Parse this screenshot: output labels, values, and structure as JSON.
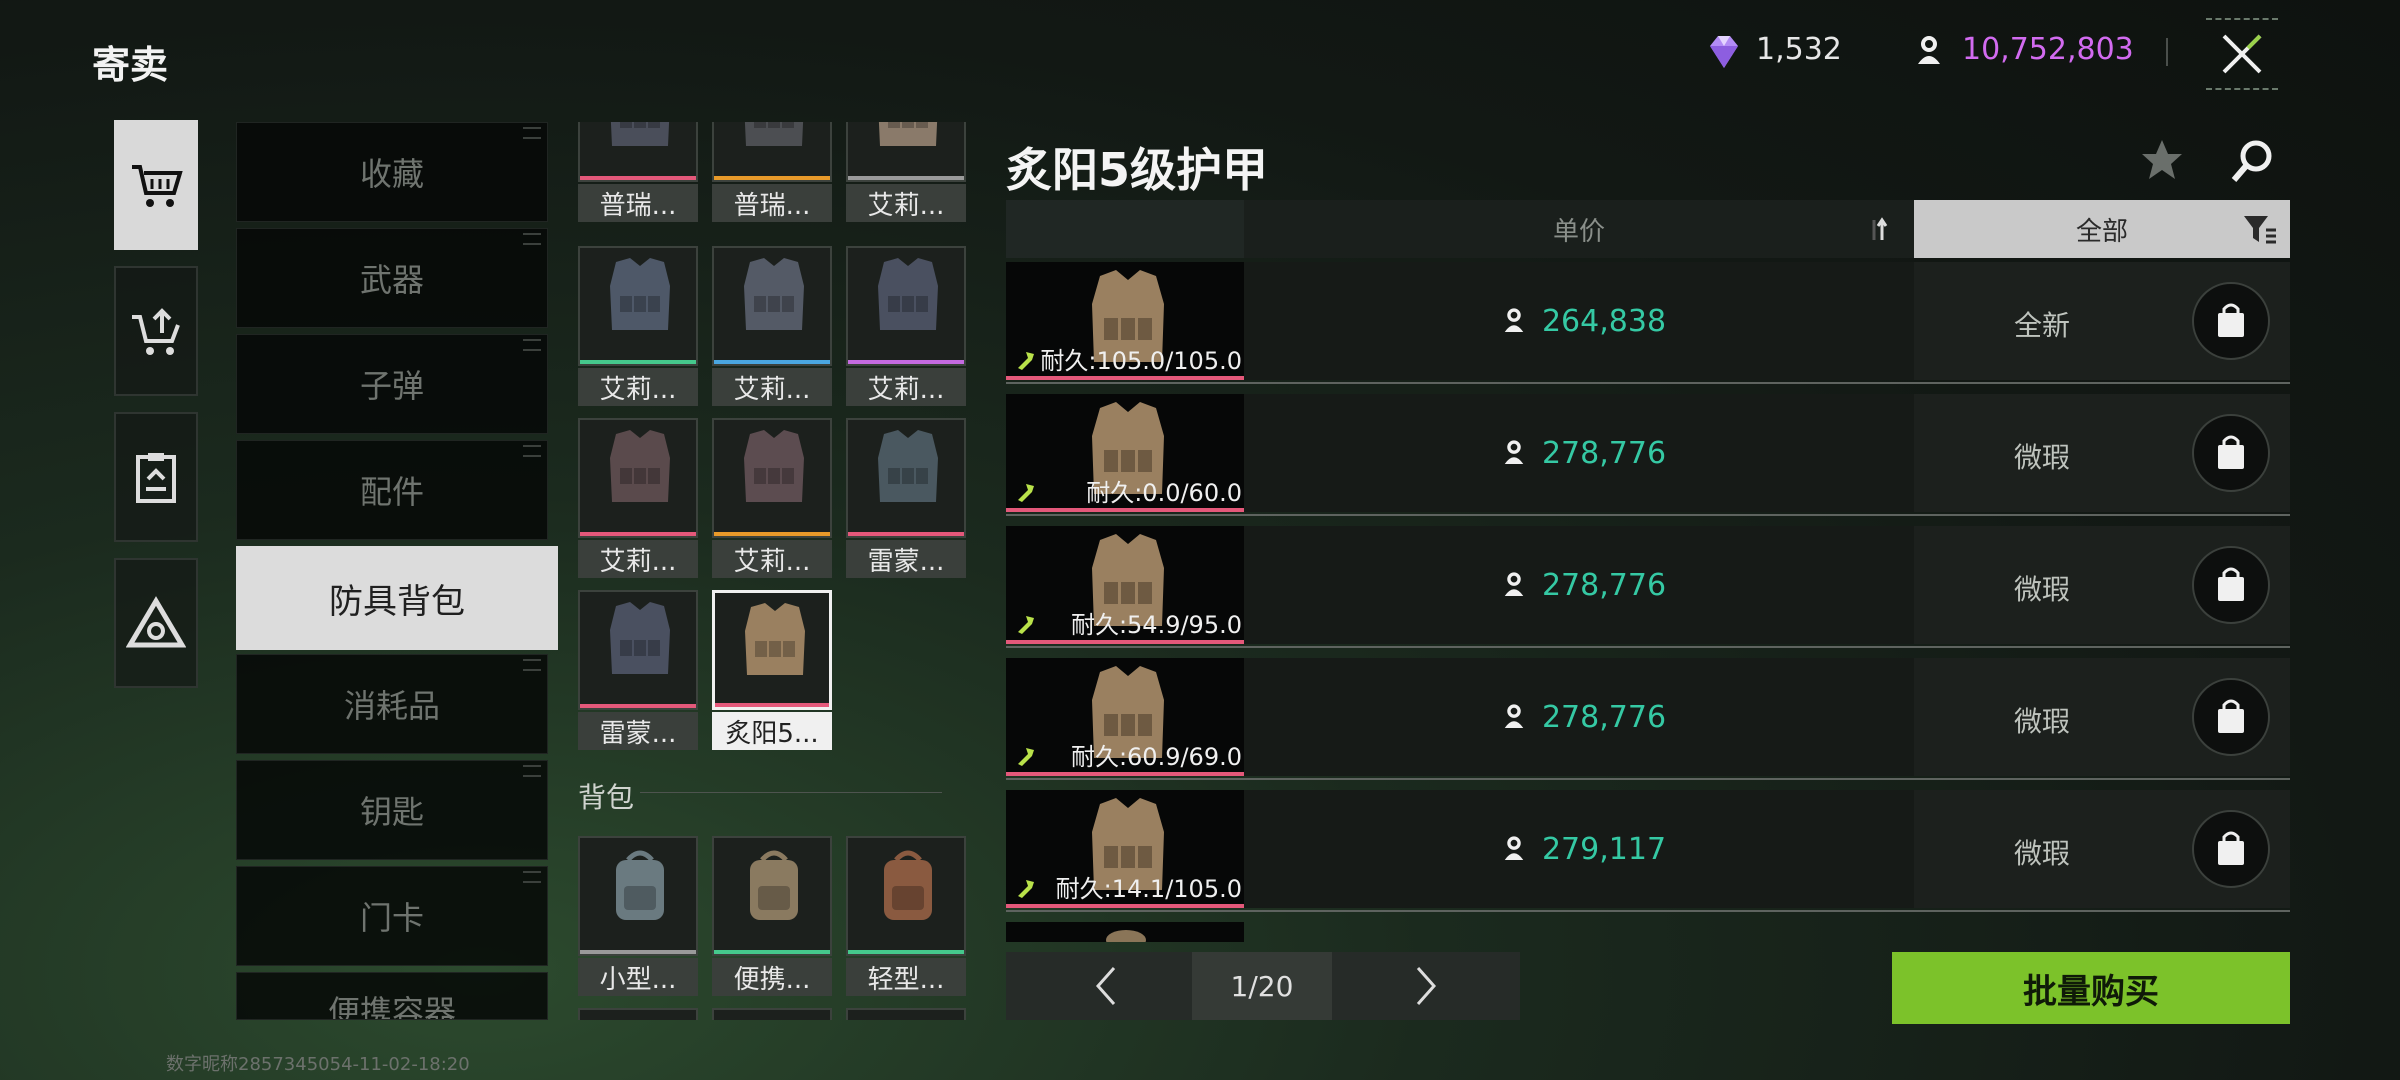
{
  "header": {
    "title": "寄卖",
    "diamonds": "1,532",
    "coins": "10,752,803",
    "close_icon": "close-icon"
  },
  "side_nav": [
    {
      "icon": "cart-icon",
      "active": true
    },
    {
      "icon": "cart-upload-icon",
      "active": false
    },
    {
      "icon": "clipboard-icon",
      "active": false
    },
    {
      "icon": "triangle-logo-icon",
      "active": false
    }
  ],
  "categories": [
    {
      "label": "收藏"
    },
    {
      "label": "武器"
    },
    {
      "label": "子弹"
    },
    {
      "label": "配件"
    },
    {
      "label": "防具背包",
      "active": true
    },
    {
      "label": "消耗品"
    },
    {
      "label": "钥匙"
    },
    {
      "label": "门卡"
    },
    {
      "label": "便携容器"
    }
  ],
  "armor_items": [
    {
      "label": "普瑞...",
      "bar": "#e4587a"
    },
    {
      "label": "普瑞...",
      "bar": "#e89a2a"
    },
    {
      "label": "艾莉...",
      "bar": "#9a9a9a"
    },
    {
      "label": "艾莉...",
      "bar": "#45c98c"
    },
    {
      "label": "艾莉...",
      "bar": "#4aa6e0"
    },
    {
      "label": "艾莉...",
      "bar": "#c46ae0"
    },
    {
      "label": "艾莉...",
      "bar": "#e4587a"
    },
    {
      "label": "艾莉...",
      "bar": "#e89a2a"
    },
    {
      "label": "雷蒙...",
      "bar": "#e4587a"
    },
    {
      "label": "雷蒙...",
      "bar": "#e4587a"
    },
    {
      "label": "炙阳5...",
      "bar": "#e4587a",
      "selected": true
    }
  ],
  "backpack_section": "背包",
  "backpack_items": [
    {
      "label": "小型...",
      "bar": "#9a9a9a"
    },
    {
      "label": "便携...",
      "bar": "#45c98c"
    },
    {
      "label": "轻型...",
      "bar": "#45c98c"
    }
  ],
  "panel": {
    "title": "炙阳5级护甲",
    "star_icon": "star-icon",
    "search_icon": "search-icon",
    "col_price": "单价",
    "col_filter": "全部",
    "sort_icon": "sort-icon",
    "filter_icon": "filter-icon"
  },
  "listings": [
    {
      "price": "264,838",
      "condition": "全新",
      "durability": "耐久:105.0/105.0"
    },
    {
      "price": "278,776",
      "condition": "微瑕",
      "durability": "耐久:0.0/60.0"
    },
    {
      "price": "278,776",
      "condition": "微瑕",
      "durability": "耐久:54.9/95.0"
    },
    {
      "price": "278,776",
      "condition": "微瑕",
      "durability": "耐久:60.9/69.0"
    },
    {
      "price": "279,117",
      "condition": "微瑕",
      "durability": "耐久:14.1/105.0"
    }
  ],
  "pagination": {
    "page": "1/20"
  },
  "bulk_buy": "批量购买",
  "watermark": "数字昵称2857345054-11-02-18:20",
  "colors": {
    "accent_green": "#7cc22a",
    "price_teal": "#35c9a4",
    "coin_purple": "#d26bf0"
  }
}
